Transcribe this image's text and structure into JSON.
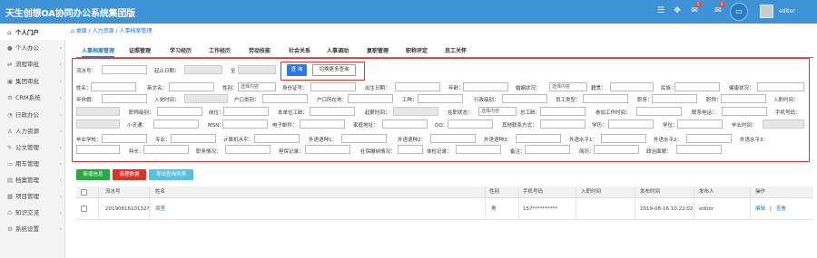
{
  "app": {
    "title": "天生创想OA协同办公系统集团版",
    "username": "editor",
    "msg_badge": "5",
    "bell_badge": "4"
  },
  "sidebar": {
    "items": [
      {
        "label": "个人门户",
        "icon": "home-icon"
      },
      {
        "label": "个人办公",
        "icon": "user-icon"
      },
      {
        "label": "流程审批",
        "icon": "flow-icon"
      },
      {
        "label": "集团审批",
        "icon": "group-icon"
      },
      {
        "label": "CRM系统",
        "icon": "crm-icon"
      },
      {
        "label": "行政办公",
        "icon": "admin-icon"
      },
      {
        "label": "人力资源",
        "icon": "hr-icon"
      },
      {
        "label": "公文管理",
        "icon": "doc-icon"
      },
      {
        "label": "用车管理",
        "icon": "car-icon"
      },
      {
        "label": "档案管理",
        "icon": "archive-icon"
      },
      {
        "label": "项目管理",
        "icon": "project-icon"
      },
      {
        "label": "知识交流",
        "icon": "knowledge-icon"
      },
      {
        "label": "系统设置",
        "icon": "settings-icon"
      }
    ]
  },
  "breadcrumb": {
    "home": "桌面",
    "level1": "人力资源",
    "level2": "人事档案管理"
  },
  "tabs": [
    "人事档案管理",
    "证照管理",
    "学习经历",
    "工作经历",
    "劳动技能",
    "社会关系",
    "人事调动",
    "复职管理",
    "职称评定",
    "员工关怀"
  ],
  "form": {
    "row1": {
      "serial": "流水号：",
      "start_date": "起止日期：",
      "to": "至"
    },
    "row2": {
      "name": "姓名：",
      "en_name": "英文名：",
      "gender": "性别：",
      "gender_select": "选择内容",
      "idcard": "身份证号：",
      "birthday": "出生日期：",
      "age": "年龄：",
      "marital": "婚姻状况：",
      "marital_select": "选择内容",
      "native": "籍贯：",
      "ethnic": "民族：",
      "health": "健康状况："
    },
    "row3": {
      "annual_leave": "年休假：",
      "join_date": "入党时间：",
      "hukou_type": "户口类别：",
      "hukou_place": "户口所在地：",
      "job_type": "工种：",
      "admin_level": "行政级别：",
      "staff_type": "员工类型：",
      "position": "职务：",
      "title": "职称：",
      "entry_time": "入职时间："
    },
    "row4": {
      "title_level": "职称级别：",
      "post": "岗位：",
      "unit_seniority": "本单位工龄：",
      "start_time": "起薪时间：",
      "status": "在职状态：",
      "status_select": "选择内容",
      "total_seniority": "总工龄：",
      "work_start": "参加工作时间：",
      "phone": "联系电话：",
      "mobile": "手机号码："
    },
    "row5": {
      "smart": "小灵通：",
      "msn": "MSN：",
      "email": "电子邮件：",
      "address": "家庭地址：",
      "qq": "QQ：",
      "other_contact": "其他联系方式：",
      "education": "学历：",
      "degree": "学位：",
      "grad_time": "毕业时间："
    },
    "row6": {
      "school": "毕业学校：",
      "major": "专业：",
      "computer": "计算机水平：",
      "lang1": "外语语种1：",
      "lang2": "外语语种2：",
      "lang3": "外语语种3：",
      "level1": "外语水平1：",
      "level2": "外语水平2：",
      "level3": "外语水平3："
    },
    "row7": {
      "skill": "特长：",
      "duty": "职务情况：",
      "security": "担保记录：",
      "social": "社保缴纳情况：",
      "physical": "体检记录：",
      "remark": "备注：",
      "resume": "简历：",
      "political": "政治面貌："
    }
  },
  "buttons": {
    "query": "查 询",
    "more": "切换更多查询",
    "add": "新增信息",
    "clear": "清理数据",
    "export": "导出查询列表"
  },
  "table": {
    "headers": [
      "流水号",
      "姓名",
      "性别",
      "手机号码",
      "入职时间",
      "发布时间",
      "发布人",
      "操作"
    ],
    "rows": [
      {
        "serial": "2019081610132?",
        "name": "周里",
        "gender": "男",
        "mobile": "157**********",
        "entry": "",
        "publish": "2019-08-16 10:22:02",
        "publisher": "editor",
        "edit": "编辑",
        "sep": "|",
        "view": "查看"
      }
    ]
  },
  "colors": {
    "topbar": "#3d93d6",
    "accent": "#2a78c2",
    "highlight_border": "#e23333",
    "btn_add": "#27a844",
    "btn_clear": "#d9342b",
    "btn_export": "#5bc0de"
  }
}
